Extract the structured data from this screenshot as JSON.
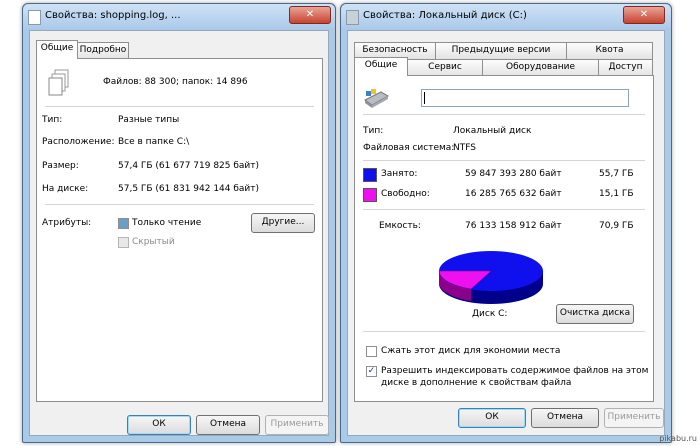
{
  "left_window": {
    "title": "Свойства: shopping.log, ...",
    "tabs": [
      "Общие",
      "Подробно"
    ],
    "summary": "Файлов: 88 300; папок: 14 896",
    "rows": [
      {
        "label": "Тип:",
        "value": "Разные типы"
      },
      {
        "label": "Расположение:",
        "value": "Все в папке C:\\"
      },
      {
        "label": "Размер:",
        "value": "57,4 ГБ (61 677 719 825 байт)"
      },
      {
        "label": "На диске:",
        "value": "57,5 ГБ (61 831 942 144 байт)"
      }
    ],
    "attributes_label": "Атрибуты:",
    "readonly_label": "Только чтение",
    "hidden_label": "Скрытый",
    "other_button": "Другие...",
    "ok": "ОК",
    "cancel": "Отмена",
    "apply": "Применить",
    "close_glyph": "✕"
  },
  "right_window": {
    "title": "Свойства: Локальный диск (C:)",
    "tabs_top": [
      "Безопасность",
      "Предыдущие версии",
      "Квота"
    ],
    "tabs_bottom": [
      "Общие",
      "Сервис",
      "Оборудование",
      "Доступ"
    ],
    "name_value": "",
    "type_label": "Тип:",
    "type_value": "Локальный диск",
    "fs_label": "Файловая система:",
    "fs_value": "NTFS",
    "used": {
      "label": "Занято:",
      "bytes": "59 847 393 280 байт",
      "gb": "55,7 ГБ",
      "color": "#1010ee"
    },
    "free": {
      "label": "Свободно:",
      "bytes": "16 285 765 632 байт",
      "gb": "15,1 ГБ",
      "color": "#ee10ee"
    },
    "capacity": {
      "label": "Емкость:",
      "bytes": "76 133 158 912 байт",
      "gb": "70,9 ГБ"
    },
    "disk_label": "Диск C:",
    "cleanup_button": "Очистка диска",
    "compress_label": "Сжать этот диск для экономии места",
    "index_label_1": "Разрешить индексировать содержимое файлов на этом",
    "index_label_2": "диске в дополнение к свойствам файла",
    "ok": "ОК",
    "cancel": "Отмена",
    "apply": "Применить",
    "close_glyph": "✕",
    "check_glyph": "✓"
  },
  "watermark": "pikabu.ru"
}
